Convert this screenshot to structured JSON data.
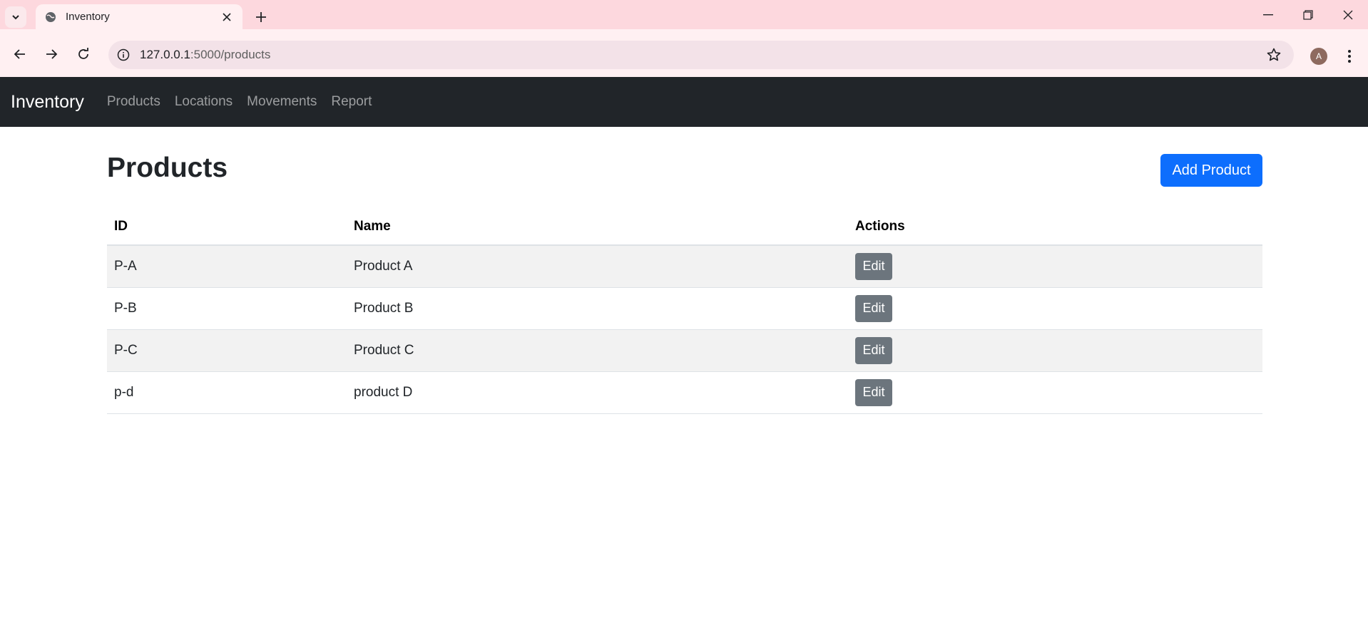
{
  "browser": {
    "tab_title": "Inventory",
    "url_host": "127.0.0.1",
    "url_path": ":5000/products",
    "avatar_letter": "A"
  },
  "app": {
    "brand": "Inventory",
    "nav": [
      {
        "label": "Products"
      },
      {
        "label": "Locations"
      },
      {
        "label": "Movements"
      },
      {
        "label": "Report"
      }
    ]
  },
  "page": {
    "title": "Products",
    "add_button_label": "Add Product"
  },
  "table": {
    "headers": [
      "ID",
      "Name",
      "Actions"
    ],
    "rows": [
      {
        "id": "P-A",
        "name": "Product A",
        "action": "Edit"
      },
      {
        "id": "P-B",
        "name": "Product B",
        "action": "Edit"
      },
      {
        "id": "P-C",
        "name": "Product C",
        "action": "Edit"
      },
      {
        "id": "p-d",
        "name": "product D",
        "action": "Edit"
      }
    ]
  },
  "colors": {
    "navbar_bg": "#212529",
    "primary": "#0d6efd",
    "secondary": "#6c757d",
    "tabbar_bg": "#fdd8de"
  }
}
